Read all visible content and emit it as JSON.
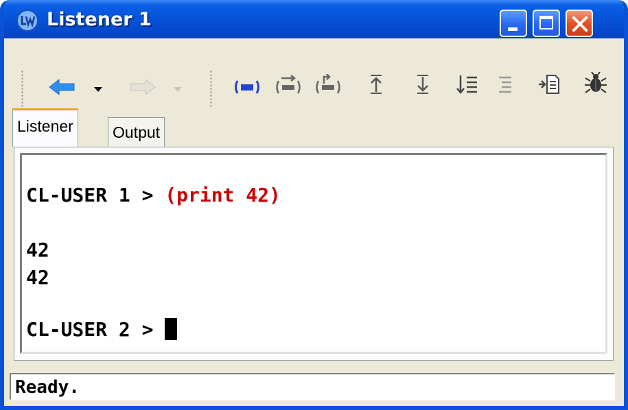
{
  "window": {
    "title": "Listener 1",
    "icon": "lw-app-icon"
  },
  "caption_buttons": {
    "minimize_icon": "minimize-icon",
    "maximize_icon": "maximize-icon",
    "close_icon": "close-icon"
  },
  "toolbar": {
    "items": [
      {
        "icon": "back-arrow-icon",
        "enabled": true
      },
      {
        "icon": "dropdown-arrow-icon",
        "enabled": true
      },
      {
        "icon": "forward-arrow-icon",
        "enabled": false
      },
      {
        "icon": "dropdown-arrow-icon",
        "enabled": false
      },
      {
        "icon": "evaluate-icon",
        "enabled": true
      },
      {
        "icon": "step-forward-icon",
        "enabled": true
      },
      {
        "icon": "step-back-icon",
        "enabled": true
      },
      {
        "icon": "previous-form-icon",
        "enabled": true
      },
      {
        "icon": "next-form-icon",
        "enabled": true
      },
      {
        "icon": "sort-list-icon",
        "enabled": true
      },
      {
        "icon": "list-icon",
        "enabled": false
      },
      {
        "icon": "document-icon",
        "enabled": true
      },
      {
        "icon": "bug-icon",
        "enabled": true
      }
    ]
  },
  "tabs": [
    {
      "label": "Listener",
      "active": true
    },
    {
      "label": "Output",
      "active": false
    }
  ],
  "listener": {
    "prompt1": "CL-USER 1 > ",
    "command1": "(print 42)",
    "output_line1": "42",
    "output_line2": "42",
    "prompt2": "CL-USER 2 > "
  },
  "status": {
    "text": "Ready."
  },
  "colors": {
    "title_bar": "#0553d8",
    "input_text": "#cc0000",
    "active_tab_accent": "#f0a030",
    "forward_arrow_disabled": "#c8c4b8",
    "back_arrow": "#2f8ff0"
  }
}
